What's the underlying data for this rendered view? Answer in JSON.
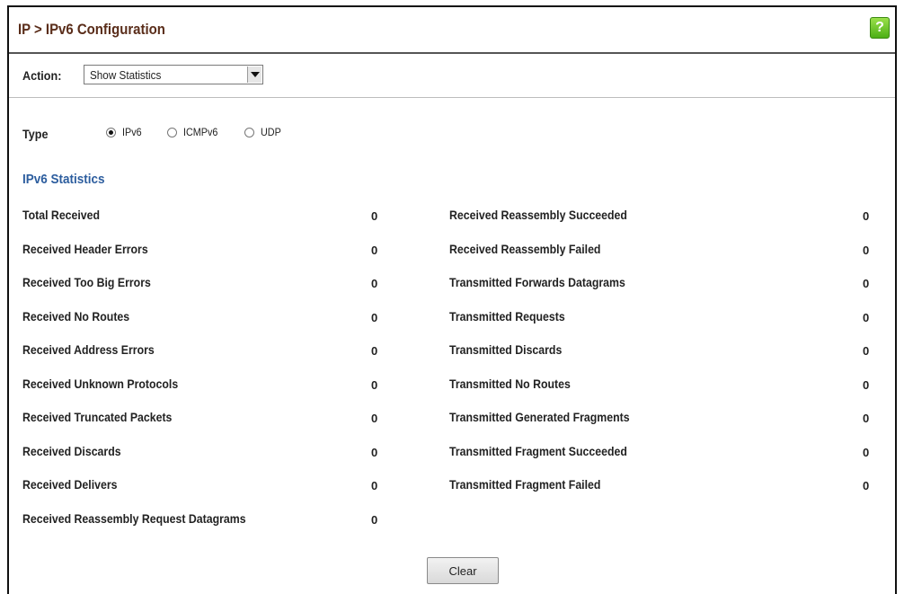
{
  "header": {
    "title": "IP > IPv6 Configuration",
    "help_icon_label": "?"
  },
  "action": {
    "label": "Action:",
    "selected": "Show Statistics"
  },
  "type": {
    "label": "Type",
    "options": [
      {
        "label": "IPv6",
        "checked": true
      },
      {
        "label": "ICMPv6",
        "checked": false
      },
      {
        "label": "UDP",
        "checked": false
      }
    ]
  },
  "section_title": "IPv6 Statistics",
  "stats_left": [
    {
      "label": "Total Received",
      "value": "0"
    },
    {
      "label": "Received Header Errors",
      "value": "0"
    },
    {
      "label": "Received Too Big Errors",
      "value": "0"
    },
    {
      "label": "Received No Routes",
      "value": "0"
    },
    {
      "label": "Received Address Errors",
      "value": "0"
    },
    {
      "label": "Received Unknown Protocols",
      "value": "0"
    },
    {
      "label": "Received Truncated Packets",
      "value": "0"
    },
    {
      "label": "Received Discards",
      "value": "0"
    },
    {
      "label": "Received Delivers",
      "value": "0"
    },
    {
      "label": "Received Reassembly Request Datagrams",
      "value": "0"
    }
  ],
  "stats_right": [
    {
      "label": "Received Reassembly Succeeded",
      "value": "0"
    },
    {
      "label": "Received Reassembly Failed",
      "value": "0"
    },
    {
      "label": "Transmitted Forwards Datagrams",
      "value": "0"
    },
    {
      "label": "Transmitted Requests",
      "value": "0"
    },
    {
      "label": "Transmitted Discards",
      "value": "0"
    },
    {
      "label": "Transmitted No Routes",
      "value": "0"
    },
    {
      "label": "Transmitted Generated Fragments",
      "value": "0"
    },
    {
      "label": "Transmitted Fragment Succeeded",
      "value": "0"
    },
    {
      "label": "Transmitted Fragment Failed",
      "value": "0"
    }
  ],
  "buttons": {
    "clear": "Clear"
  }
}
